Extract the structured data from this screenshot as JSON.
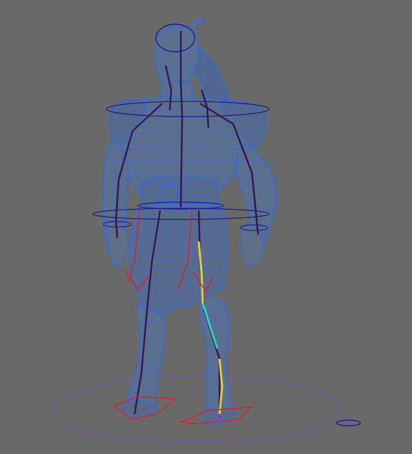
{
  "viewport": {
    "background": "#6a6a6a",
    "panel_type": "3d-viewport"
  },
  "character": {
    "wireframe_color": "#2b6be8",
    "shade_color": "#5f6f86",
    "skeleton_color": "#3a1455",
    "display_mode": "wireframe-on-shaded"
  },
  "rig_controls": {
    "control_circle_color": "#1c1c8a",
    "ik_curve_colors": [
      "#e6d12a",
      "#28d6c8",
      "#9f2fe0"
    ],
    "foot_control_color": "#e01c2a",
    "ground_circle_color": "#7a4fb0"
  }
}
